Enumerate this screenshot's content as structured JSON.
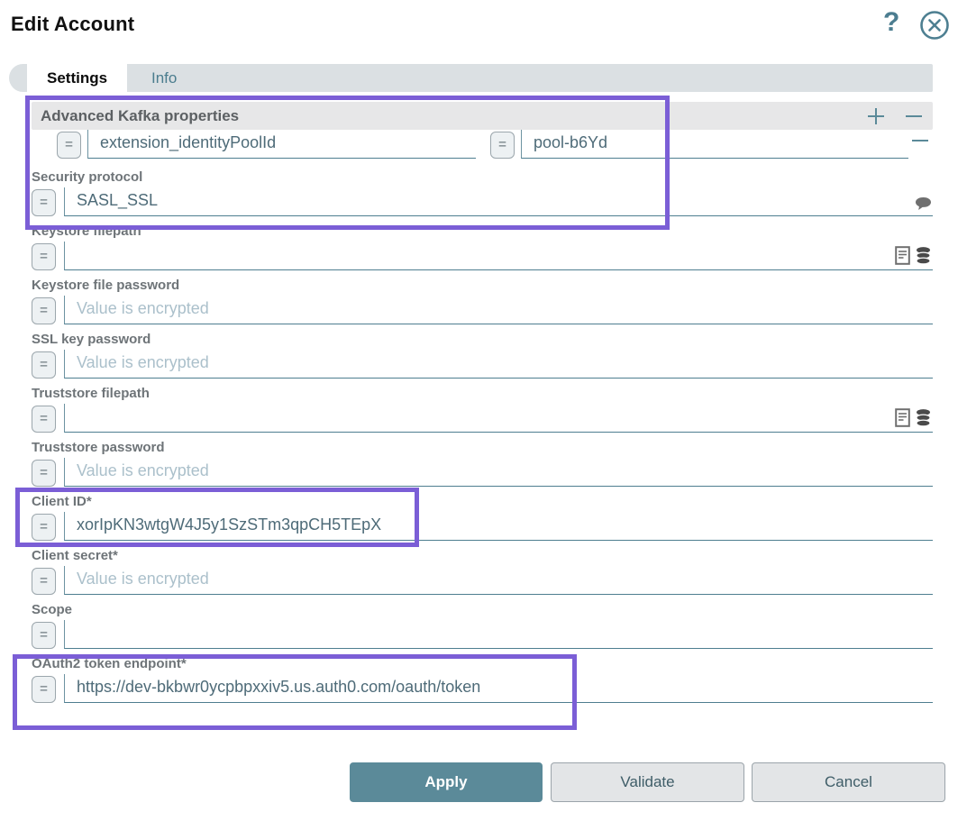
{
  "dialog": {
    "title": "Edit Account",
    "help_icon": "?",
    "close_icon": "circled-x",
    "tabs": [
      {
        "label": "Settings",
        "active": true
      },
      {
        "label": "Info",
        "active": false
      }
    ],
    "section": {
      "title": "Advanced Kafka properties",
      "add_icon": "plus",
      "collapse_icon": "minus"
    },
    "kv_row": {
      "key": "extension_identityPoolId",
      "value": "pool-b6Yd",
      "remove_icon": "minus"
    },
    "encrypted_placeholder": "Value is encrypted",
    "fields": [
      {
        "label": "Security protocol",
        "value": "SASL_SSL",
        "placeholder": "",
        "icons": [
          "comment-icon"
        ]
      },
      {
        "label": "Keystore filepath",
        "value": "",
        "placeholder": "",
        "icons": [
          "file-icon",
          "database-icon"
        ]
      },
      {
        "label": "Keystore file password",
        "value": "",
        "placeholder": "Value is encrypted",
        "icons": []
      },
      {
        "label": "SSL key password",
        "value": "",
        "placeholder": "Value is encrypted",
        "icons": []
      },
      {
        "label": "Truststore filepath",
        "value": "",
        "placeholder": "",
        "icons": [
          "file-icon",
          "database-icon"
        ]
      },
      {
        "label": "Truststore password",
        "value": "",
        "placeholder": "Value is encrypted",
        "icons": []
      },
      {
        "label": "Client ID*",
        "value": "xorIpKN3wtgW4J5y1SzSTm3qpCH5TEpX",
        "placeholder": "",
        "icons": []
      },
      {
        "label": "Client secret*",
        "value": "",
        "placeholder": "Value is encrypted",
        "icons": []
      },
      {
        "label": "Scope",
        "value": "",
        "placeholder": "",
        "icons": []
      },
      {
        "label": "OAuth2 token endpoint*",
        "value": "https://dev-bkbwr0ycpbpxxiv5.us.auth0.com/oauth/token",
        "placeholder": "",
        "icons": []
      }
    ],
    "buttons": {
      "apply": "Apply",
      "validate": "Validate",
      "cancel": "Cancel"
    },
    "colors": {
      "accent_teal": "#4e7e90",
      "button_teal": "#5b8a99",
      "highlight_purple": "#7b5ed6"
    }
  }
}
